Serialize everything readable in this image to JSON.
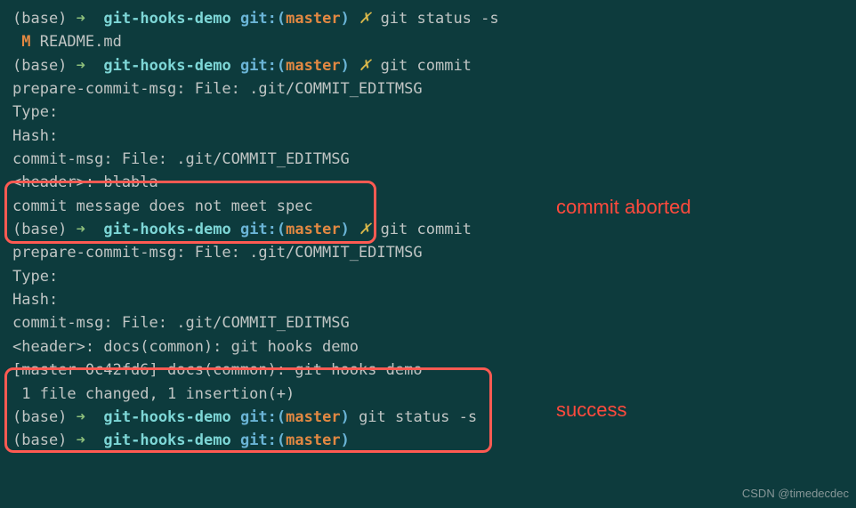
{
  "prompt": {
    "base": "(base)",
    "arrow": "➜",
    "folder": "git-hooks-demo",
    "gitlabel": "git:(",
    "branch": "master",
    "gitclose": ")",
    "dirty": "✗"
  },
  "lines": {
    "cmd_status_s": "git status -s",
    "mod_marker": " M ",
    "modified_file": "README.md",
    "cmd_commit": "git commit",
    "prepare_msg": "prepare-commit-msg: File: .git/COMMIT_EDITMSG",
    "type": "Type:",
    "hash": "Hash:",
    "commit_msg_file": "commit-msg: File: .git/COMMIT_EDITMSG",
    "header_blabla": "<header>: blabla",
    "not_meet_spec": "commit message does not meet spec",
    "header_docs": "<header>: docs(common): git hooks demo",
    "master_hash": "[master 0c42fd6] docs(common): git hooks demo",
    "files_changed": " 1 file changed, 1 insertion(+)"
  },
  "annotations": {
    "aborted": "commit aborted",
    "success": "success"
  },
  "watermark": "CSDN @timedecdec"
}
